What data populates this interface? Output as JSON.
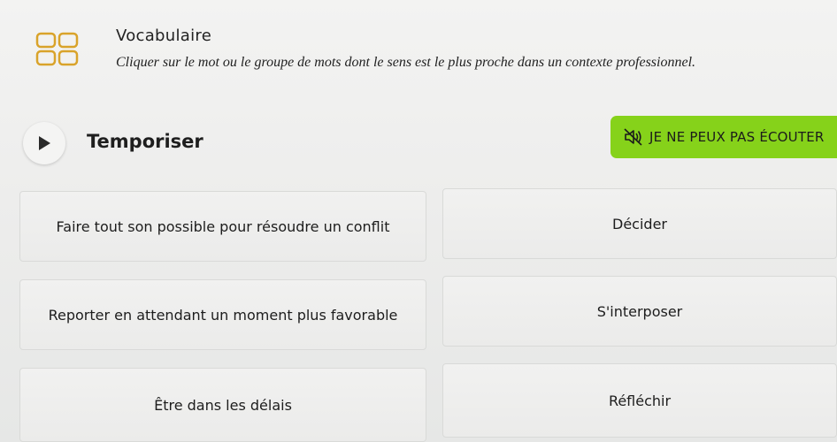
{
  "header": {
    "icon": "grid-icon",
    "title": "Vocabulaire",
    "instruction": "Cliquer sur le mot ou le groupe de mots dont le sens est le plus proche dans un contexte professionnel."
  },
  "prompt": {
    "play_icon": "play-icon",
    "word": "Temporiser"
  },
  "listen": {
    "icon": "speaker-muted-icon",
    "label": "JE NE PEUX PAS ÉCOUTER",
    "color": "#86d21a"
  },
  "options": [
    {
      "label": "Faire tout son possible pour résoudre un conflit"
    },
    {
      "label": "Décider"
    },
    {
      "label": "Reporter en attendant un moment plus favorable"
    },
    {
      "label": "S'interposer"
    },
    {
      "label": "Être dans les délais"
    },
    {
      "label": "Réfléchir"
    }
  ]
}
